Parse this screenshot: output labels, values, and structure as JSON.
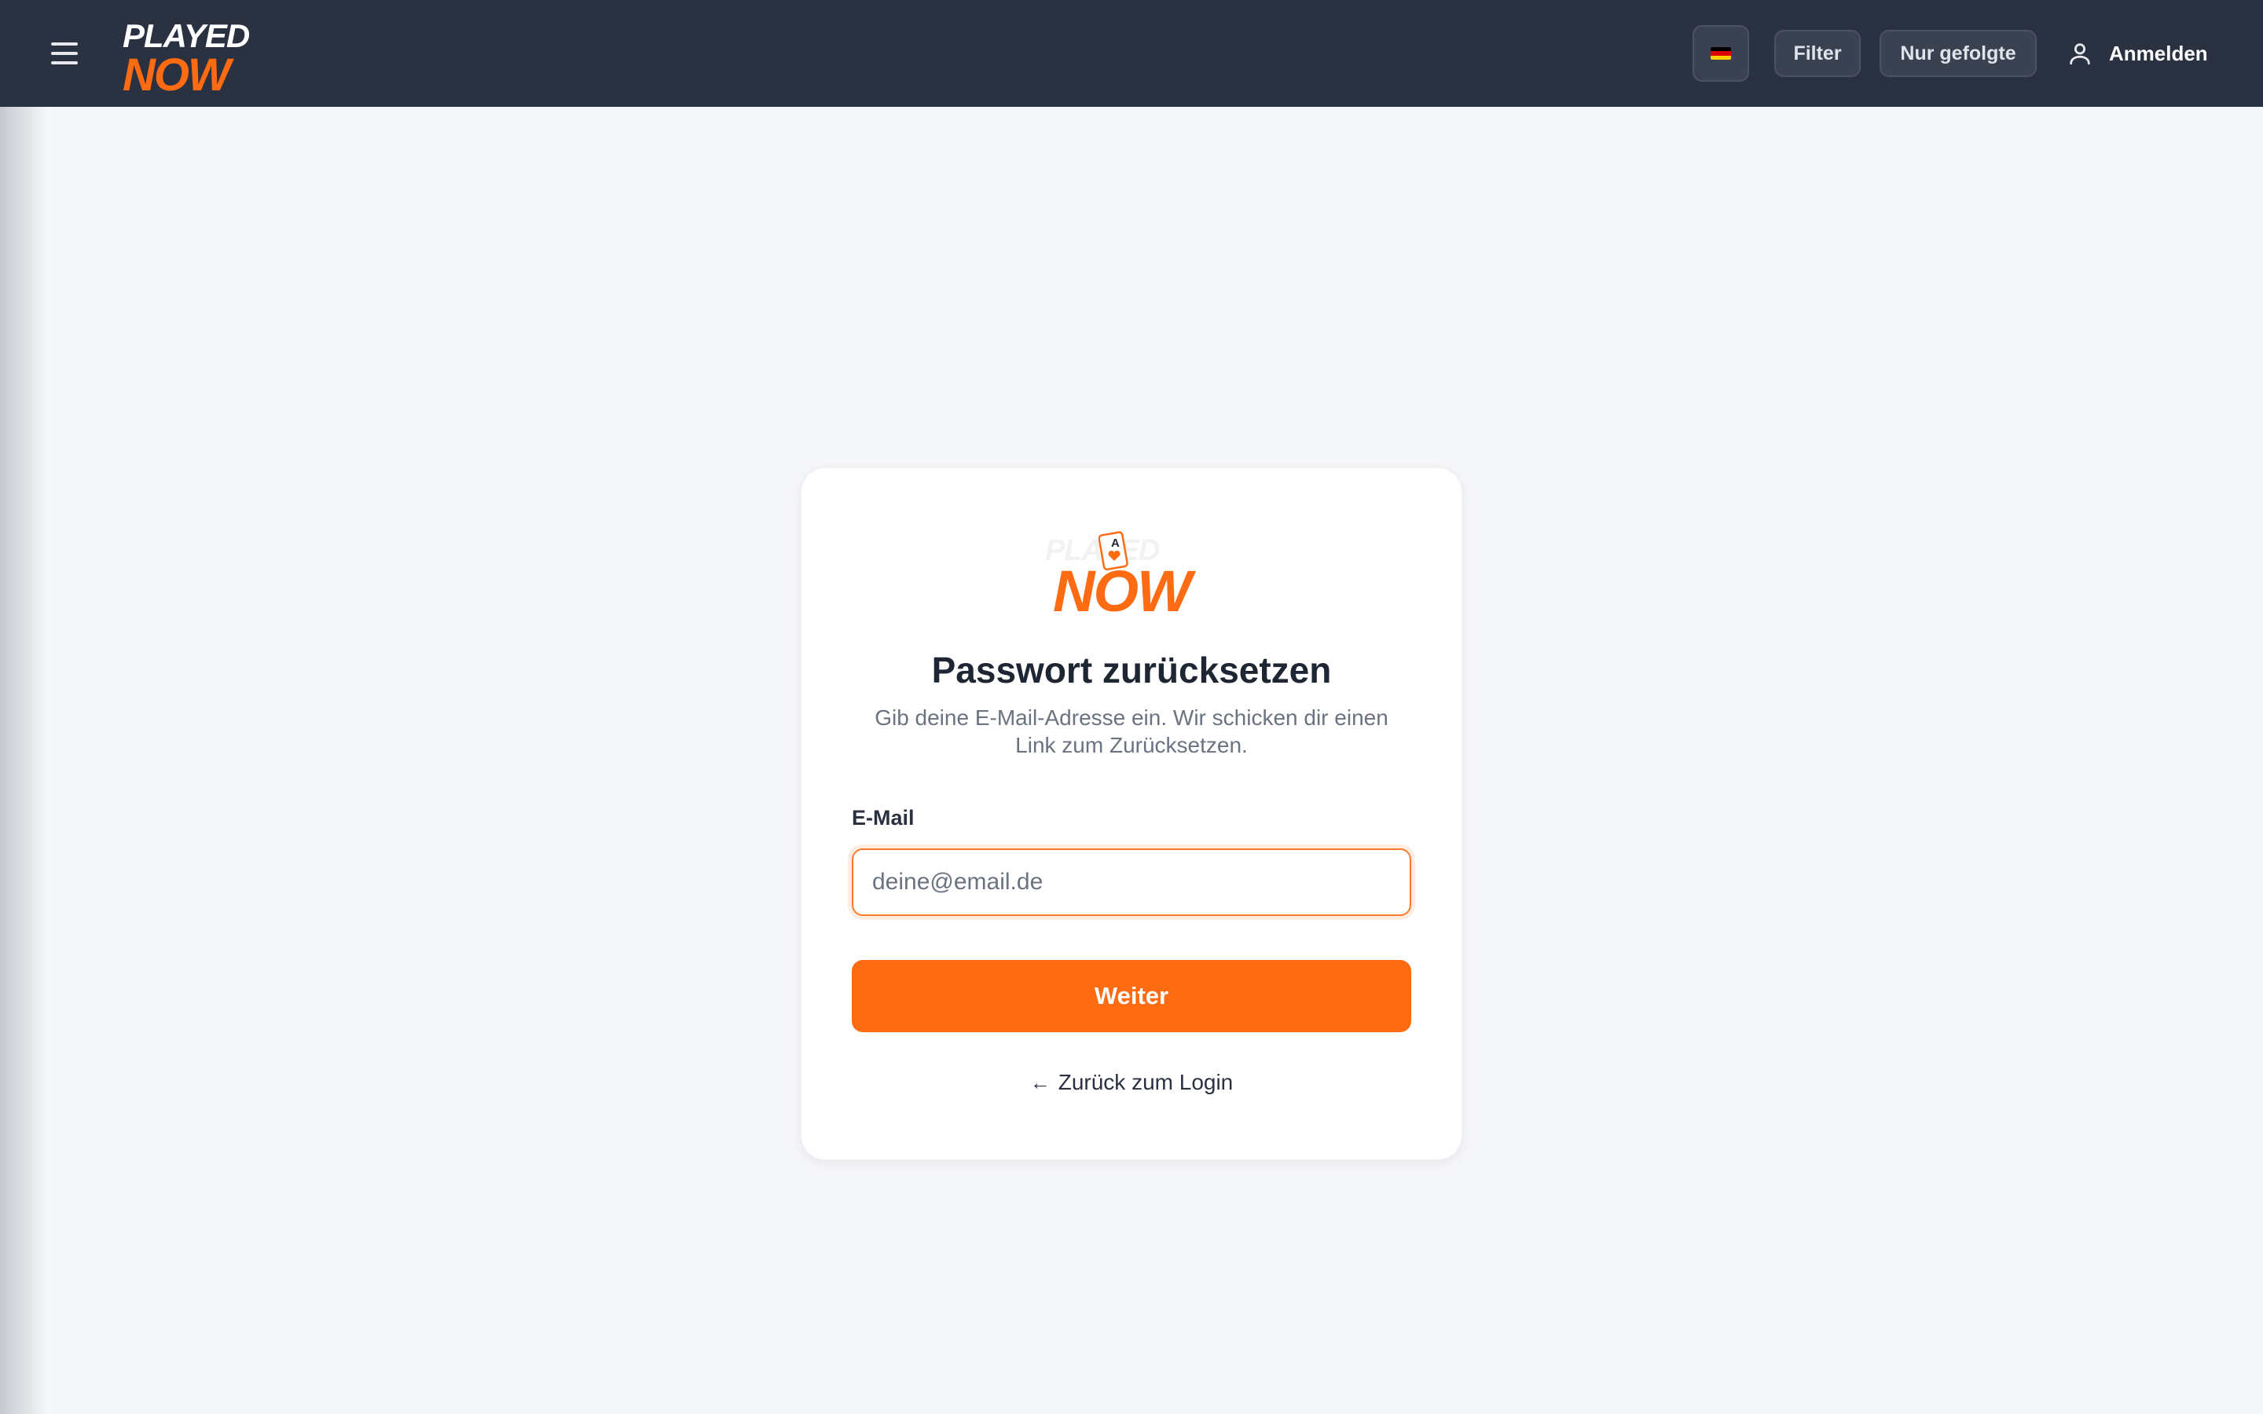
{
  "header": {
    "logo_line1": "PLAYED",
    "logo_line2": "NOW",
    "language_flag": "de-flag-icon",
    "filter_label": "Filter",
    "followed_label": "Nur gefolgte",
    "login_label": "Anmelden"
  },
  "card": {
    "logo_line1": "PLAYED",
    "logo_line2": "NOW",
    "title": "Passwort zurücksetzen",
    "subtitle": "Gib deine E-Mail-Adresse ein. Wir schicken dir einen Link zum Zurücksetzen.",
    "email_label": "E-Mail",
    "email_placeholder": "deine@email.de",
    "email_value": "",
    "submit_label": "Weiter",
    "back_label": "Zurück zum Login",
    "back_arrow": "←"
  },
  "colors": {
    "accent": "#ff6b12",
    "topbar": "#2a3140",
    "background": "#f6f7f9"
  }
}
